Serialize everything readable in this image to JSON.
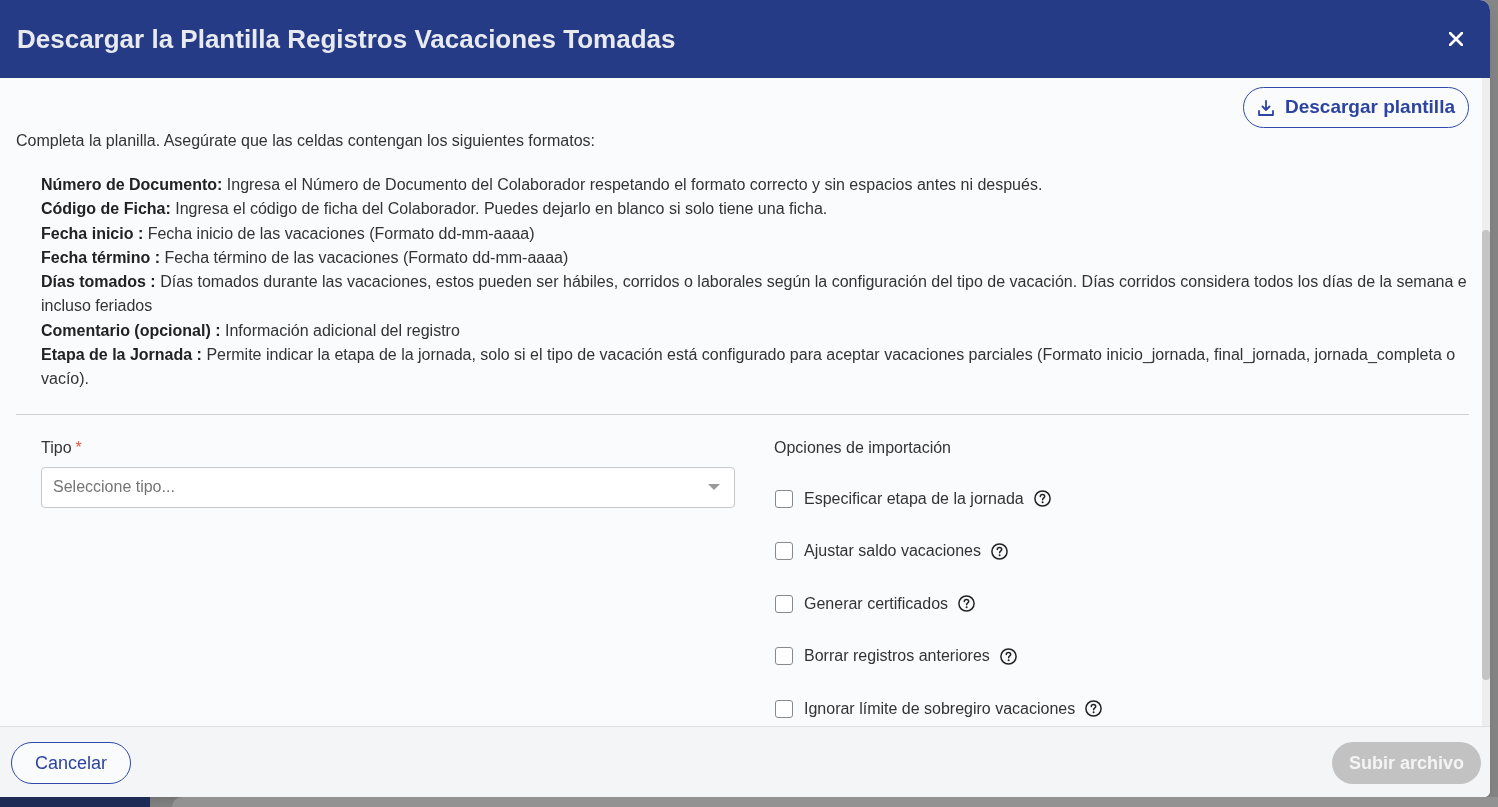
{
  "dialog": {
    "title": "Descargar la Plantilla Registros Vacaciones Tomadas",
    "download_button": "Descargar plantilla",
    "instructions": "Completa la planilla. Asegúrate que las celdas contengan los siguientes formatos:",
    "formats": [
      "**Número de Documento:** Ingresa el Número de Documento del Colaborador respetando el formato correcto y sin espacios antes ni después.",
      "**Código de Ficha:** Ingresa el código de ficha del Colaborador. Puedes dejarlo en blanco si solo tiene una ficha.",
      "**Fecha inicio :** Fecha inicio de las vacaciones (Formato dd-mm-aaaa)",
      "**Fecha término :** Fecha término de las vacaciones (Formato dd-mm-aaaa)",
      "**Días tomados :** Días tomados durante las vacaciones, estos pueden ser hábiles, corridos o laborales según la configuración del tipo de vacación. Días corridos considera todos los días de la semana e incluso feriados",
      "**Comentario (opcional) :** Información adicional del registro",
      "**Etapa de la Jornada :** Permite indicar la etapa de la jornada, solo si el tipo de vacación está configurado para aceptar vacaciones parciales (Formato inicio_jornada, final_jornada, jornada_completa o vacío)."
    ],
    "type_field": {
      "label": "Tipo",
      "required_mark": "*",
      "placeholder": "Seleccione tipo..."
    },
    "import_options": {
      "title": "Opciones de importación",
      "options": [
        {
          "label": "Especificar etapa de la jornada",
          "checked": false
        },
        {
          "label": "Ajustar saldo vacaciones",
          "checked": false
        },
        {
          "label": "Generar certificados",
          "checked": false
        },
        {
          "label": "Borrar registros anteriores",
          "checked": false
        },
        {
          "label": "Ignorar límite de sobregiro vacaciones",
          "checked": false
        }
      ]
    },
    "footer": {
      "cancel_button": "Cancelar",
      "submit_button": {
        "label": "Subir archivo",
        "disabled": true
      }
    }
  }
}
